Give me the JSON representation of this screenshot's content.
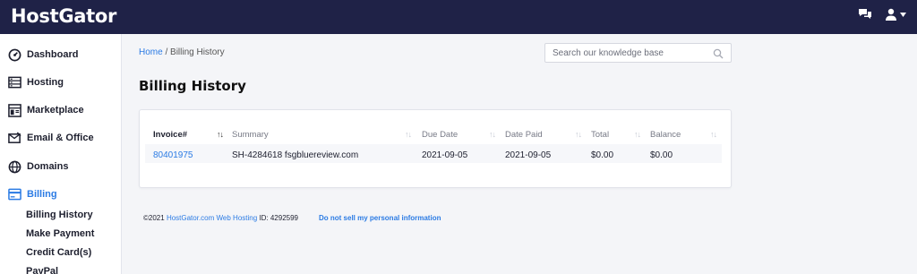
{
  "header": {
    "logo": "HostGator",
    "chat_icon": "chat-bubbles-icon",
    "user_icon": "user-icon"
  },
  "sidebar": {
    "items": [
      {
        "label": "Dashboard",
        "icon": "dashboard-gauge-icon"
      },
      {
        "label": "Hosting",
        "icon": "server-icon"
      },
      {
        "label": "Marketplace",
        "icon": "store-icon"
      },
      {
        "label": "Email & Office",
        "icon": "envelope-icon"
      },
      {
        "label": "Domains",
        "icon": "globe-icon"
      },
      {
        "label": "Billing",
        "icon": "credit-card-icon",
        "active": true
      }
    ],
    "billing_sub": [
      "Billing History",
      "Make Payment",
      "Credit Card(s)",
      "PayPal"
    ]
  },
  "breadcrumb": {
    "home": "Home",
    "separator": "/",
    "current": "Billing History"
  },
  "search": {
    "placeholder": "Search our knowledge base"
  },
  "page": {
    "title": "Billing History"
  },
  "table": {
    "columns": [
      "Invoice#",
      "Summary",
      "Due Date",
      "Date Paid",
      "Total",
      "Balance"
    ],
    "rows": [
      {
        "invoice": "80401975",
        "summary": "SH-4284618 fsgbluereview.com",
        "due_date": "2021-09-05",
        "date_paid": "2021-09-05",
        "total": "$0.00",
        "balance": "$0.00"
      }
    ]
  },
  "footer": {
    "copyright": "©2021",
    "company_link": "HostGator.com Web Hosting",
    "id_text": "ID: 4292599",
    "do_not_sell": "Do not sell my personal information"
  },
  "colors": {
    "topbar": "#1f2247",
    "accent": "#2b7be4"
  }
}
